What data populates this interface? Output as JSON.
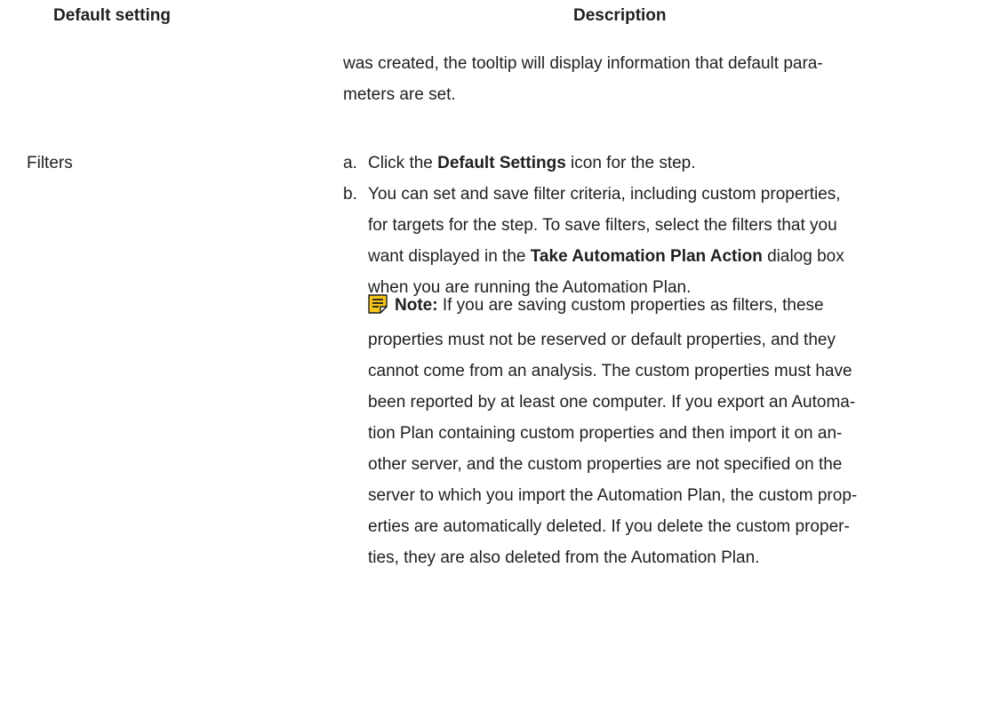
{
  "table": {
    "headers": {
      "setting": "Default setting",
      "description": "Description"
    },
    "continuation": [
      "was created, the tooltip will display information that default para-",
      "meters are set."
    ],
    "rows": [
      {
        "setting": "Filters",
        "steps": [
          {
            "marker": "a.",
            "lines": [
              {
                "pre": "Click the ",
                "bold": "Default Settings",
                "post": " icon for the step."
              }
            ]
          },
          {
            "marker": "b.",
            "lines": [
              {
                "pre": "You can set and save filter criteria, including custom properties,",
                "bold": "",
                "post": ""
              },
              {
                "pre": "for targets for the step. To save filters, select the filters that you",
                "bold": "",
                "post": ""
              },
              {
                "pre": "want displayed in the ",
                "bold": "Take Automation Plan Action",
                "post": " dialog box"
              },
              {
                "pre": "when you are running the Automation Plan.",
                "bold": "",
                "post": ""
              }
            ]
          }
        ],
        "note": {
          "icon": "note-icon",
          "icon_color": "#f5c518",
          "label": "Note:",
          "lines": [
            " If you are saving custom properties as filters, these",
            "properties must not be reserved or default properties, and they",
            "cannot come from an analysis. The custom properties must have",
            "been reported by at least one computer. If you export an Automa-",
            "tion Plan containing custom properties and then import it on an-",
            "other server, and the custom properties are not specified on the",
            "server to which you import the Automation Plan, the custom prop-",
            "erties are automatically deleted. If you delete the custom proper-",
            "ties, they are also deleted from the Automation Plan."
          ]
        }
      }
    ]
  }
}
